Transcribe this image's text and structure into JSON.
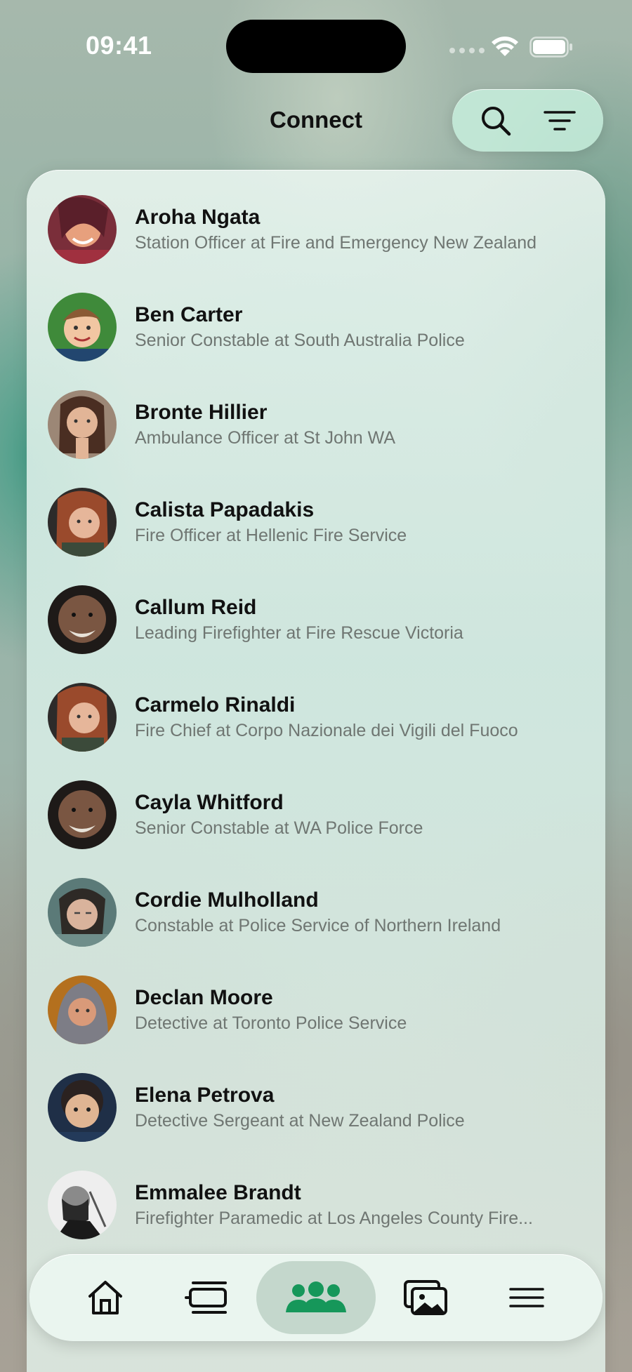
{
  "status_bar": {
    "time": "09:41"
  },
  "header": {
    "title": "Connect"
  },
  "header_actions": {
    "search_icon": "search-icon",
    "filter_icon": "filter-icon"
  },
  "contacts": [
    {
      "name": "Aroha Ngata",
      "role": "Station Officer at Fire and Emergency New Zealand"
    },
    {
      "name": "Ben Carter",
      "role": "Senior Constable at South Australia Police"
    },
    {
      "name": "Bronte Hillier",
      "role": "Ambulance Officer at St John WA"
    },
    {
      "name": "Calista Papadakis",
      "role": "Fire Officer at Hellenic Fire Service"
    },
    {
      "name": "Callum Reid",
      "role": "Leading Firefighter at Fire Rescue Victoria"
    },
    {
      "name": "Carmelo Rinaldi",
      "role": "Fire Chief at Corpo Nazionale dei Vigili del Fuoco"
    },
    {
      "name": "Cayla Whitford",
      "role": "Senior Constable at WA Police Force"
    },
    {
      "name": "Cordie Mulholland",
      "role": "Constable at Police Service of Northern Ireland"
    },
    {
      "name": "Declan Moore",
      "role": "Detective at Toronto Police Service"
    },
    {
      "name": "Elena Petrova",
      "role": "Detective Sergeant at New Zealand Police"
    },
    {
      "name": "Emmalee Brandt",
      "role": "Firefighter Paramedic at Los Angeles County Fire..."
    }
  ],
  "tab_bar": {
    "tabs": [
      {
        "icon": "home-icon",
        "active": false
      },
      {
        "icon": "feed-icon",
        "active": false
      },
      {
        "icon": "people-icon",
        "active": true
      },
      {
        "icon": "gallery-icon",
        "active": false
      },
      {
        "icon": "menu-icon",
        "active": false
      }
    ]
  },
  "colors": {
    "accent": "#16975a",
    "text": "#111111",
    "subtext": "#6f7672"
  }
}
